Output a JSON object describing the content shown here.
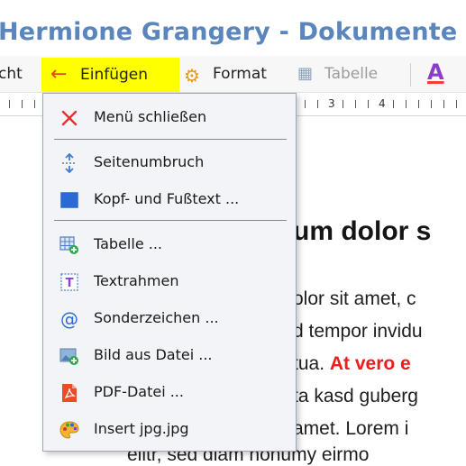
{
  "window": {
    "title": "Hermione Grangery - Dokumente - N"
  },
  "menubar": {
    "view_partial": "cht",
    "insert_label": "Einfügen",
    "format_label": "Format",
    "table_label": "Tabelle",
    "font_color_glyph": "A"
  },
  "ruler": {
    "numbers": [
      "3",
      "4"
    ]
  },
  "insert_menu": {
    "items": [
      {
        "label": "Menü schließen",
        "icon": "close-icon"
      },
      {
        "label": "Seitenumbruch",
        "icon": "page-break-icon"
      },
      {
        "label": "Kopf- und Fußtext ...",
        "icon": "header-footer-icon"
      },
      {
        "label": "Tabelle ...",
        "icon": "insert-table-icon"
      },
      {
        "label": "Textrahmen",
        "icon": "text-frame-icon"
      },
      {
        "label": "Sonderzeichen ...",
        "icon": "special-character-icon"
      },
      {
        "label": "Bild aus Datei ...",
        "icon": "insert-image-icon"
      },
      {
        "label": "PDF-Datei ...",
        "icon": "pdf-icon"
      },
      {
        "label": "Insert jpg.jpg",
        "icon": "palette-icon"
      }
    ]
  },
  "document": {
    "heading": "um dolor s",
    "lines": [
      "olor sit amet, c",
      "d tempor invidu",
      "tua. ",
      "ta kasd guberg",
      "amet. Lorem i",
      "elitr, sed diam nonumy eirmo"
    ],
    "red_text": "At vero e"
  },
  "colors": {
    "title": "#5b86bd",
    "highlight": "#ffff00",
    "accent_red": "#ee1c1c"
  }
}
